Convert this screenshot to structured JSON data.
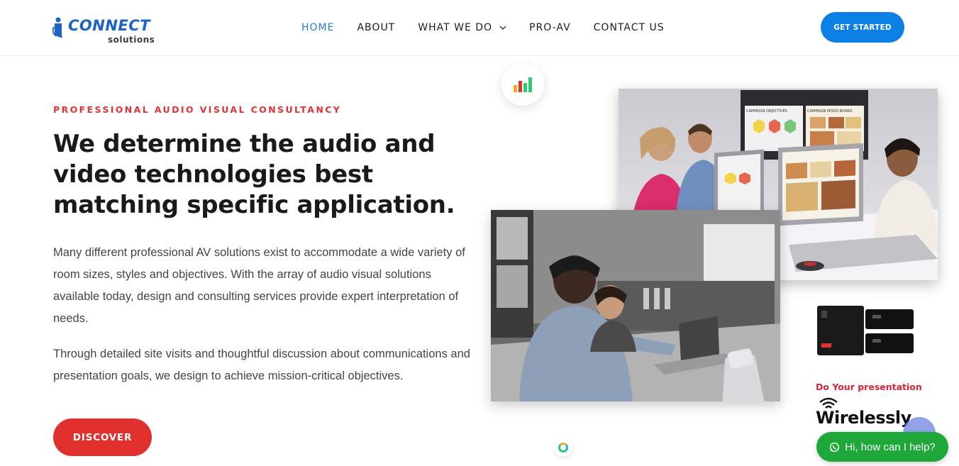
{
  "brand": {
    "logo_main": "CONNECT",
    "logo_sub": "solutions",
    "accent": "#0b7fe3",
    "red": "#e0312f"
  },
  "nav": {
    "items": [
      {
        "label": "HOME",
        "active": true
      },
      {
        "label": "ABOUT"
      },
      {
        "label": "WHAT WE DO",
        "has_dropdown": true
      },
      {
        "label": "PRO-AV"
      },
      {
        "label": "CONTACT US"
      }
    ],
    "cta": "GET STARTED"
  },
  "hero": {
    "eyebrow": "PROFESSIONAL AUDIO VISUAL CONSULTANCY",
    "headline": "We determine the audio and video technologies best matching specific application.",
    "para1": "Many different professional AV solutions exist to accommodate a wide variety of room sizes, styles and objectives. With the array of audio visual solutions available today, design and consulting services provide expert interpretation of needs.",
    "para2": "Through detailed site visits and thoughtful discussion about communications and presentation goals, we design  to achieve mission-critical objectives.",
    "cta": "DISCOVER"
  },
  "promo": {
    "tagline": "Do Your presentation",
    "big": "Wirelessly",
    "screen_left": "CAMPAIGN OBJECTIVES",
    "screen_right": "CAMPAIGN MOOD BOARD"
  },
  "chat": {
    "label": "Hi, how can I help?"
  }
}
